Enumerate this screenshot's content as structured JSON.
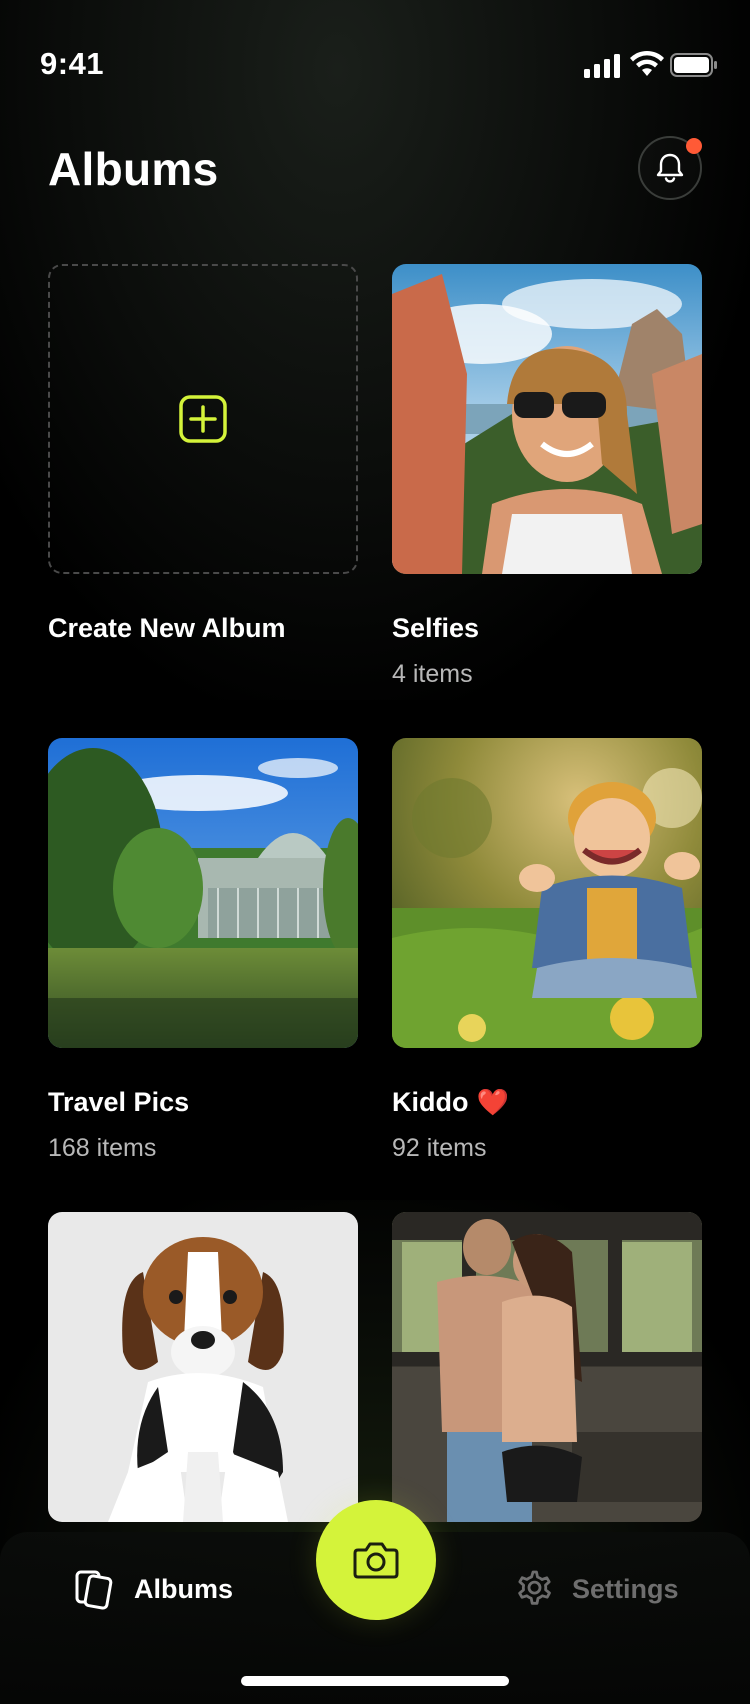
{
  "status_bar": {
    "time": "9:41"
  },
  "header": {
    "title": "Albums",
    "has_notification": true
  },
  "albums": [
    {
      "name": "Create New Album",
      "count": "",
      "type": "create"
    },
    {
      "name": "Selfies",
      "count": "4 items",
      "type": "photo"
    },
    {
      "name": "Travel Pics",
      "count": "168 items",
      "type": "photo"
    },
    {
      "name": "Kiddo",
      "emoji": "❤️",
      "count": "92 items",
      "type": "photo"
    },
    {
      "name": "",
      "count": "",
      "type": "photo"
    },
    {
      "name": "",
      "count": "",
      "type": "photo"
    }
  ],
  "tab_bar": {
    "albums_label": "Albums",
    "settings_label": "Settings"
  },
  "colors": {
    "accent": "#d4f33a",
    "notification": "#ff5a36",
    "background": "#000000"
  },
  "icons": {
    "create": "plus-square-icon",
    "bell": "bell-icon",
    "albums": "albums-icon",
    "settings": "gear-icon",
    "camera": "camera-icon"
  }
}
